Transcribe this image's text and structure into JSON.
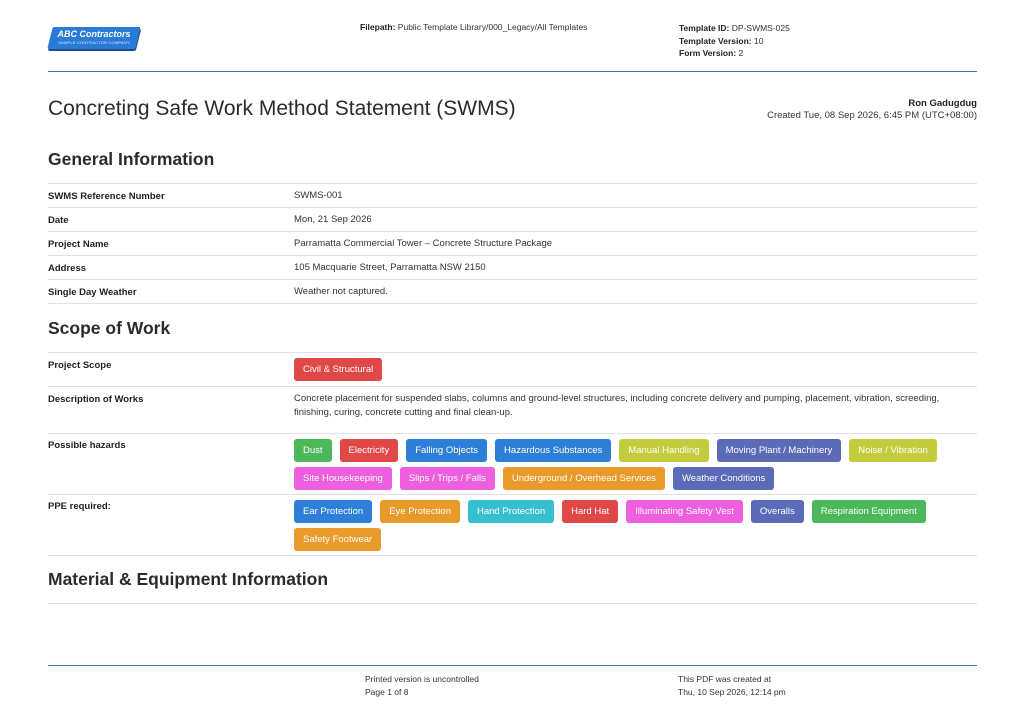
{
  "logo": {
    "name": "ABC Contractors",
    "tagline": "SAMPLE CONTRACTOR COMPANY"
  },
  "header": {
    "filepath_label": "Filepath:",
    "filepath": "Public Template Library/000_Legacy/All Templates",
    "template_id_label": "Template ID:",
    "template_id": "DP-SWMS-025",
    "template_version_label": "Template Version:",
    "template_version": "10",
    "form_version_label": "Form Version:",
    "form_version": "2"
  },
  "title": "Concreting Safe Work Method Statement (SWMS)",
  "creator": {
    "name": "Ron Gadugdug",
    "created": "Created Tue, 08 Sep 2026, 6:45 PM (UTC+08:00)"
  },
  "general": {
    "heading": "General Information",
    "rows": [
      {
        "label": "SWMS Reference Number",
        "value": "SWMS-001"
      },
      {
        "label": "Date",
        "value": "Mon, 21 Sep 2026"
      },
      {
        "label": "Project Name",
        "value": "Parramatta Commercial Tower – Concrete Structure Package"
      },
      {
        "label": "Address",
        "value": "105 Macquarie Street, Parramatta NSW 2150"
      },
      {
        "label": "Single Day Weather",
        "value": "Weather not captured."
      }
    ]
  },
  "scope": {
    "heading": "Scope of Work",
    "project_scope_label": "Project Scope",
    "project_scope": [
      {
        "text": "Civil & Structural",
        "color": "#e04848"
      }
    ],
    "description_label": "Description of Works",
    "description": "Concrete placement for suspended slabs, columns and ground-level structures, including concrete delivery and pumping, placement, vibration, screeding, finishing, curing, concrete cutting and final clean-up.",
    "hazards_label": "Possible hazards",
    "hazards": [
      {
        "text": "Dust",
        "color": "#4cb85a"
      },
      {
        "text": "Electricity",
        "color": "#e04848"
      },
      {
        "text": "Falling Objects",
        "color": "#2d7fd8"
      },
      {
        "text": "Hazardous Substances",
        "color": "#2d7fd8"
      },
      {
        "text": "Manual Handling",
        "color": "#c3cc3c"
      },
      {
        "text": "Moving Plant / Machinery",
        "color": "#5b6bb8"
      },
      {
        "text": "Noise / Vibration",
        "color": "#c3cc3c"
      },
      {
        "text": "Site Housekeeping",
        "color": "#ee5fe0"
      },
      {
        "text": "Slips / Trips / Falls",
        "color": "#ee5fe0"
      },
      {
        "text": "Underground / Overhead Services",
        "color": "#e89a2a"
      },
      {
        "text": "Weather Conditions",
        "color": "#5b6bb8"
      }
    ],
    "ppe_label": "PPE required:",
    "ppe": [
      {
        "text": "Ear Protection",
        "color": "#2d7fd8"
      },
      {
        "text": "Eye Protection",
        "color": "#e89a2a"
      },
      {
        "text": "Hand Protection",
        "color": "#36bfcf"
      },
      {
        "text": "Hard Hat",
        "color": "#e04848"
      },
      {
        "text": "Illuminating Safety Vest",
        "color": "#ee5fe0"
      },
      {
        "text": "Overalls",
        "color": "#5b6bb8"
      },
      {
        "text": "Respiration Equipment",
        "color": "#4cb85a"
      },
      {
        "text": "Safety Footwear",
        "color": "#e89a2a"
      }
    ]
  },
  "material": {
    "heading": "Material & Equipment Information"
  },
  "footer": {
    "uncontrolled": "Printed version is uncontrolled",
    "page": "Page 1 of 8",
    "created_label": "This PDF was created at",
    "created": "Thu, 10 Sep 2026, 12:14 pm"
  }
}
